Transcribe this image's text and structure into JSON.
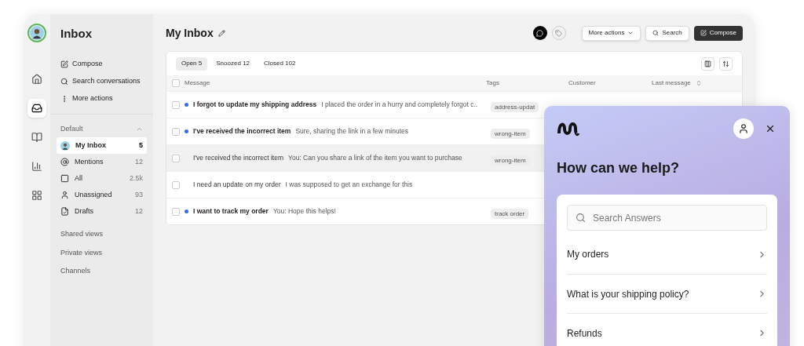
{
  "sidebar": {
    "title": "Inbox",
    "actions": [
      {
        "kind": "compose",
        "label": "Compose"
      },
      {
        "kind": "search",
        "label": "Search conversations"
      },
      {
        "kind": "more",
        "label": "More actions"
      }
    ],
    "section": {
      "label": "Default",
      "expanded": true
    },
    "items": [
      {
        "kind": "avatar",
        "label": "My Inbox",
        "count": "5",
        "selected": true
      },
      {
        "kind": "mention",
        "label": "Mentions",
        "count": "12",
        "selected": false
      },
      {
        "kind": "all",
        "label": "All",
        "count": "2.5k",
        "selected": false
      },
      {
        "kind": "user",
        "label": "Unassigned",
        "count": "93",
        "selected": false
      },
      {
        "kind": "draft",
        "label": "Drafts",
        "count": "12",
        "selected": false
      }
    ],
    "groups": [
      "Shared views",
      "Private views",
      "Channels"
    ]
  },
  "rail": [
    {
      "kind": "home",
      "selected": false
    },
    {
      "kind": "inbox",
      "selected": true
    },
    {
      "kind": "book",
      "selected": false
    },
    {
      "kind": "chart",
      "selected": false
    },
    {
      "kind": "apps",
      "selected": false
    }
  ],
  "header": {
    "title": "My Inbox",
    "buttons": [
      {
        "kind": "more",
        "label": "More actions"
      },
      {
        "kind": "search",
        "label": "Search"
      },
      {
        "kind": "compose",
        "label": "Compose"
      }
    ]
  },
  "tabs": [
    {
      "label": "Open 5",
      "selected": true
    },
    {
      "label": "Snoozed 12",
      "selected": false
    },
    {
      "label": "Closed 102",
      "selected": false
    }
  ],
  "table": {
    "all_checked": false,
    "columns": [
      "Message",
      "Tags",
      "Customer",
      "Last message"
    ],
    "rows": [
      {
        "unread": true,
        "subject": "I forgot to update my shipping address",
        "preview": "I placed the order in a hurry and completely forgot c..",
        "tag": "address-updat",
        "highlighted": false
      },
      {
        "unread": true,
        "subject": "I've received the incorrect item",
        "preview": "Sure, sharing the link in a few minutes",
        "tag": "wrong-item",
        "highlighted": false
      },
      {
        "unread": false,
        "subject": "I've received the incorrect item",
        "preview": "You: Can you share a link of the item you want to purchase",
        "tag": "wrong-item",
        "highlighted": true
      },
      {
        "unread": false,
        "subject": "I need an update on my order",
        "preview": "I was supposed to get an exchange for this",
        "highlighted": false
      },
      {
        "unread": true,
        "subject": "I want to track my order",
        "preview": "You: Hope this helps!",
        "tag": "track order",
        "highlighted": false
      }
    ]
  },
  "widget": {
    "title": "How can we help?",
    "search": {
      "placeholder": "Search Answers"
    },
    "items": [
      "My orders",
      "What is your shipping policy?",
      "Refunds"
    ]
  }
}
